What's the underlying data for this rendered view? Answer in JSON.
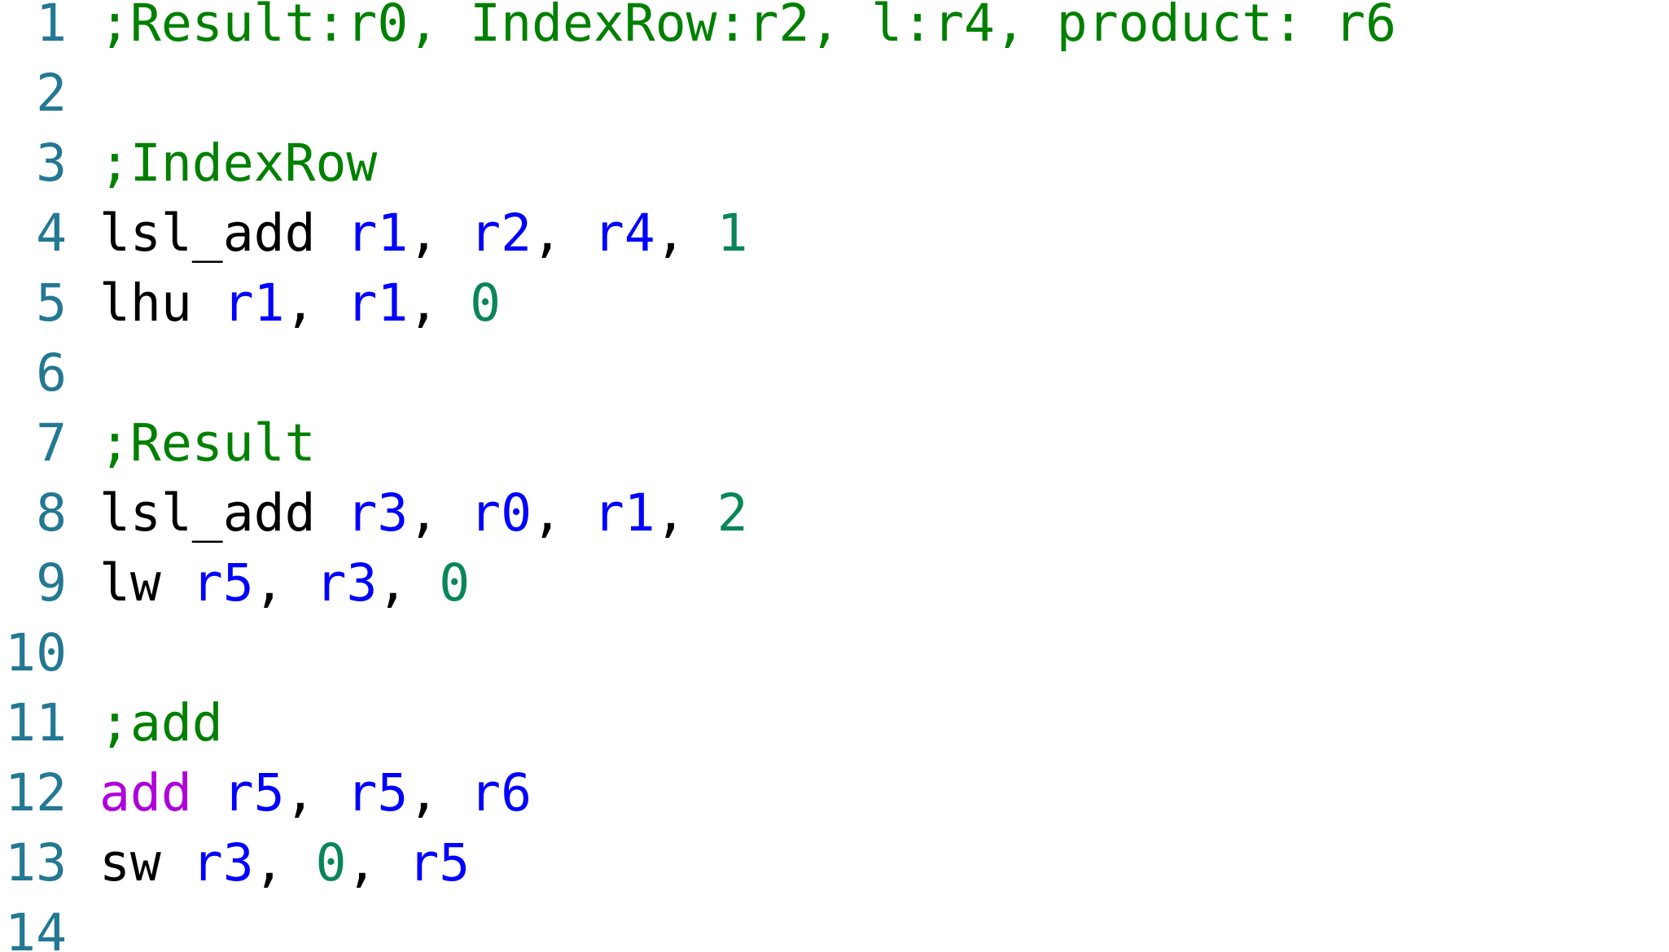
{
  "editor": {
    "line_number_color": "#237893",
    "token_colors": {
      "comment": "#008000",
      "register": "#0000ff",
      "number": "#098658",
      "keyword": "#af00db",
      "plain": "#000000"
    },
    "lines": [
      {
        "num": "1",
        "tokens": [
          {
            "t": "comment",
            "v": ";Result:r0, IndexRow:r2, l:r4, product: r6"
          }
        ]
      },
      {
        "num": "2",
        "tokens": []
      },
      {
        "num": "3",
        "tokens": [
          {
            "t": "comment",
            "v": ";IndexRow"
          }
        ]
      },
      {
        "num": "4",
        "tokens": [
          {
            "t": "plain",
            "v": "lsl_add "
          },
          {
            "t": "reg",
            "v": "r1"
          },
          {
            "t": "plain",
            "v": ", "
          },
          {
            "t": "reg",
            "v": "r2"
          },
          {
            "t": "plain",
            "v": ", "
          },
          {
            "t": "reg",
            "v": "r4"
          },
          {
            "t": "plain",
            "v": ", "
          },
          {
            "t": "num",
            "v": "1"
          }
        ]
      },
      {
        "num": "5",
        "tokens": [
          {
            "t": "plain",
            "v": "lhu "
          },
          {
            "t": "reg",
            "v": "r1"
          },
          {
            "t": "plain",
            "v": ", "
          },
          {
            "t": "reg",
            "v": "r1"
          },
          {
            "t": "plain",
            "v": ", "
          },
          {
            "t": "num",
            "v": "0"
          }
        ]
      },
      {
        "num": "6",
        "tokens": []
      },
      {
        "num": "7",
        "tokens": [
          {
            "t": "comment",
            "v": ";Result"
          }
        ]
      },
      {
        "num": "8",
        "tokens": [
          {
            "t": "plain",
            "v": "lsl_add "
          },
          {
            "t": "reg",
            "v": "r3"
          },
          {
            "t": "plain",
            "v": ", "
          },
          {
            "t": "reg",
            "v": "r0"
          },
          {
            "t": "plain",
            "v": ", "
          },
          {
            "t": "reg",
            "v": "r1"
          },
          {
            "t": "plain",
            "v": ", "
          },
          {
            "t": "num",
            "v": "2"
          }
        ]
      },
      {
        "num": "9",
        "tokens": [
          {
            "t": "plain",
            "v": "lw "
          },
          {
            "t": "reg",
            "v": "r5"
          },
          {
            "t": "plain",
            "v": ", "
          },
          {
            "t": "reg",
            "v": "r3"
          },
          {
            "t": "plain",
            "v": ", "
          },
          {
            "t": "num",
            "v": "0"
          }
        ]
      },
      {
        "num": "10",
        "tokens": []
      },
      {
        "num": "11",
        "tokens": [
          {
            "t": "comment",
            "v": ";add"
          }
        ]
      },
      {
        "num": "12",
        "tokens": [
          {
            "t": "kw",
            "v": "add"
          },
          {
            "t": "plain",
            "v": " "
          },
          {
            "t": "reg",
            "v": "r5"
          },
          {
            "t": "plain",
            "v": ", "
          },
          {
            "t": "reg",
            "v": "r5"
          },
          {
            "t": "plain",
            "v": ", "
          },
          {
            "t": "reg",
            "v": "r6"
          }
        ]
      },
      {
        "num": "13",
        "tokens": [
          {
            "t": "plain",
            "v": "sw "
          },
          {
            "t": "reg",
            "v": "r3"
          },
          {
            "t": "plain",
            "v": ", "
          },
          {
            "t": "num",
            "v": "0"
          },
          {
            "t": "plain",
            "v": ", "
          },
          {
            "t": "reg",
            "v": "r5"
          }
        ]
      },
      {
        "num": "14",
        "tokens": []
      }
    ]
  }
}
